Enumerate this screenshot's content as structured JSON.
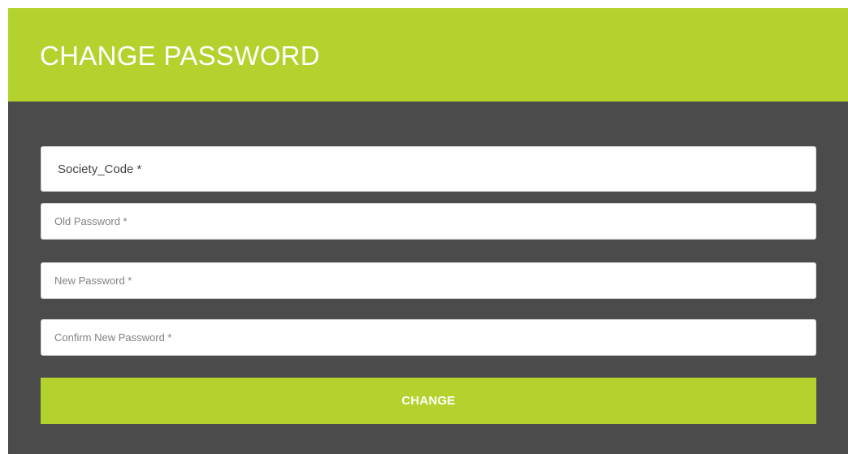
{
  "form": {
    "title": "CHANGE PASSWORD",
    "fields": {
      "society_code": {
        "placeholder": "Society_Code *",
        "value": ""
      },
      "old_password": {
        "placeholder": "Old Password *",
        "value": ""
      },
      "new_password": {
        "placeholder": "New Password *",
        "value": ""
      },
      "confirm_new_password": {
        "placeholder": "Confirm New Password *",
        "value": ""
      }
    },
    "submit_label": "CHANGE"
  },
  "colors": {
    "accent": "#b3d22e",
    "panel_background": "#4b4b4b",
    "field_background": "#ffffff",
    "title_text": "#ffffff"
  }
}
